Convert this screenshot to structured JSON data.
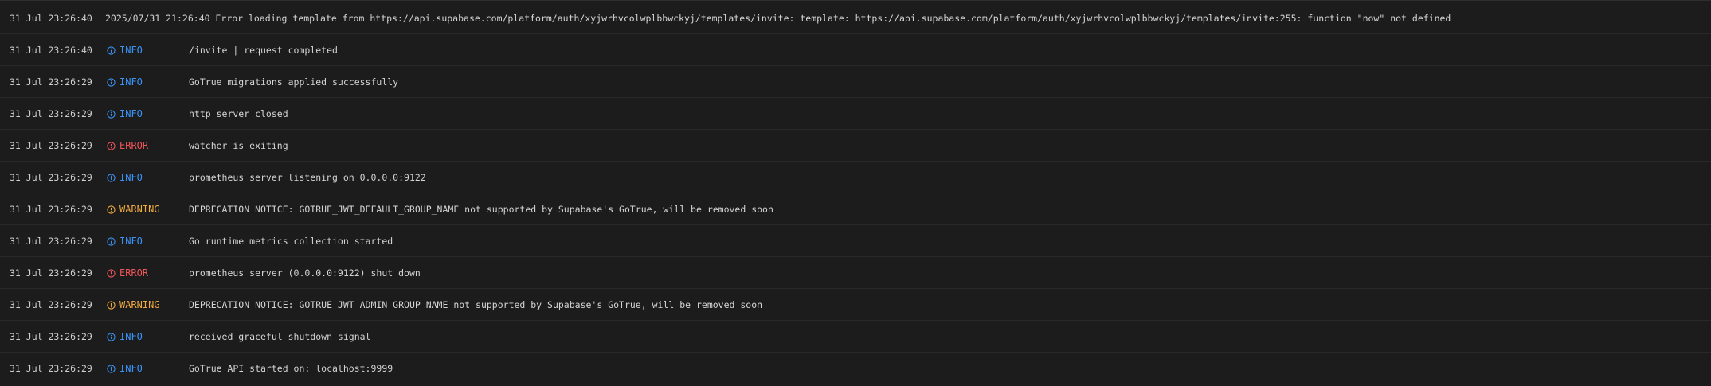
{
  "colors": {
    "background": "#1c1c1c",
    "info": "#3b93f7",
    "error": "#f0555a",
    "warning": "#f0a93f",
    "text": "#d4d4d4"
  },
  "icons": {
    "info": "info-circle-icon",
    "error": "alert-circle-icon",
    "warning": "alert-circle-icon"
  },
  "logs": [
    {
      "timestamp": "31 Jul 23:26:40",
      "level": "",
      "message": "2025/07/31 21:26:40 Error loading template from https://api.supabase.com/platform/auth/xyjwrhvcolwplbbwckyj/templates/invite: template: https://api.supabase.com/platform/auth/xyjwrhvcolwplbbwckyj/templates/invite:255: function \"now\" not defined"
    },
    {
      "timestamp": "31 Jul 23:26:40",
      "level": "INFO",
      "message": "/invite | request completed"
    },
    {
      "timestamp": "31 Jul 23:26:29",
      "level": "INFO",
      "message": "GoTrue migrations applied successfully"
    },
    {
      "timestamp": "31 Jul 23:26:29",
      "level": "INFO",
      "message": "http server closed"
    },
    {
      "timestamp": "31 Jul 23:26:29",
      "level": "ERROR",
      "message": "watcher is exiting"
    },
    {
      "timestamp": "31 Jul 23:26:29",
      "level": "INFO",
      "message": "prometheus server listening on 0.0.0.0:9122"
    },
    {
      "timestamp": "31 Jul 23:26:29",
      "level": "WARNING",
      "message": "DEPRECATION NOTICE: GOTRUE_JWT_DEFAULT_GROUP_NAME not supported by Supabase's GoTrue, will be removed soon"
    },
    {
      "timestamp": "31 Jul 23:26:29",
      "level": "INFO",
      "message": "Go runtime metrics collection started"
    },
    {
      "timestamp": "31 Jul 23:26:29",
      "level": "ERROR",
      "message": "prometheus server (0.0.0.0:9122) shut down"
    },
    {
      "timestamp": "31 Jul 23:26:29",
      "level": "WARNING",
      "message": "DEPRECATION NOTICE: GOTRUE_JWT_ADMIN_GROUP_NAME not supported by Supabase's GoTrue, will be removed soon"
    },
    {
      "timestamp": "31 Jul 23:26:29",
      "level": "INFO",
      "message": "received graceful shutdown signal"
    },
    {
      "timestamp": "31 Jul 23:26:29",
      "level": "INFO",
      "message": "GoTrue API started on: localhost:9999"
    }
  ]
}
